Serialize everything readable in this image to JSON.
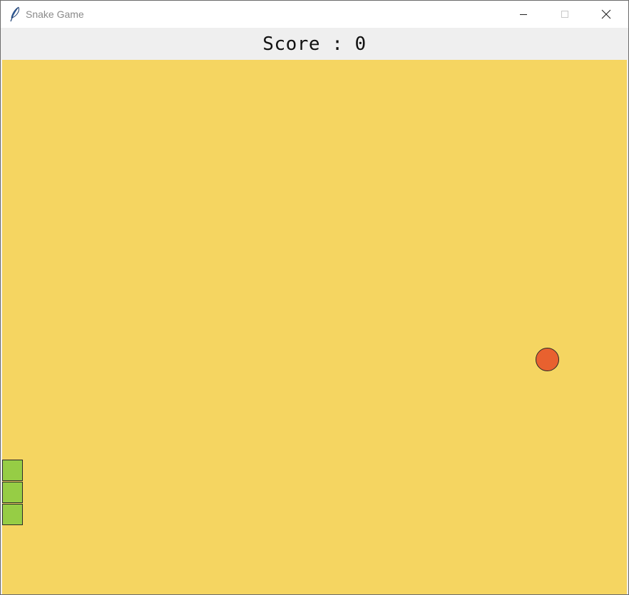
{
  "window": {
    "title": "Snake Game",
    "icon": "feather-icon",
    "controls": [
      "minimize-icon",
      "maximize-icon",
      "close-icon"
    ]
  },
  "score": {
    "text": "Score : 0"
  },
  "game": {
    "board_color": "#f5d561",
    "snake_color": "#96cd45",
    "food_color": "#e8612f",
    "snake_length": 3
  }
}
